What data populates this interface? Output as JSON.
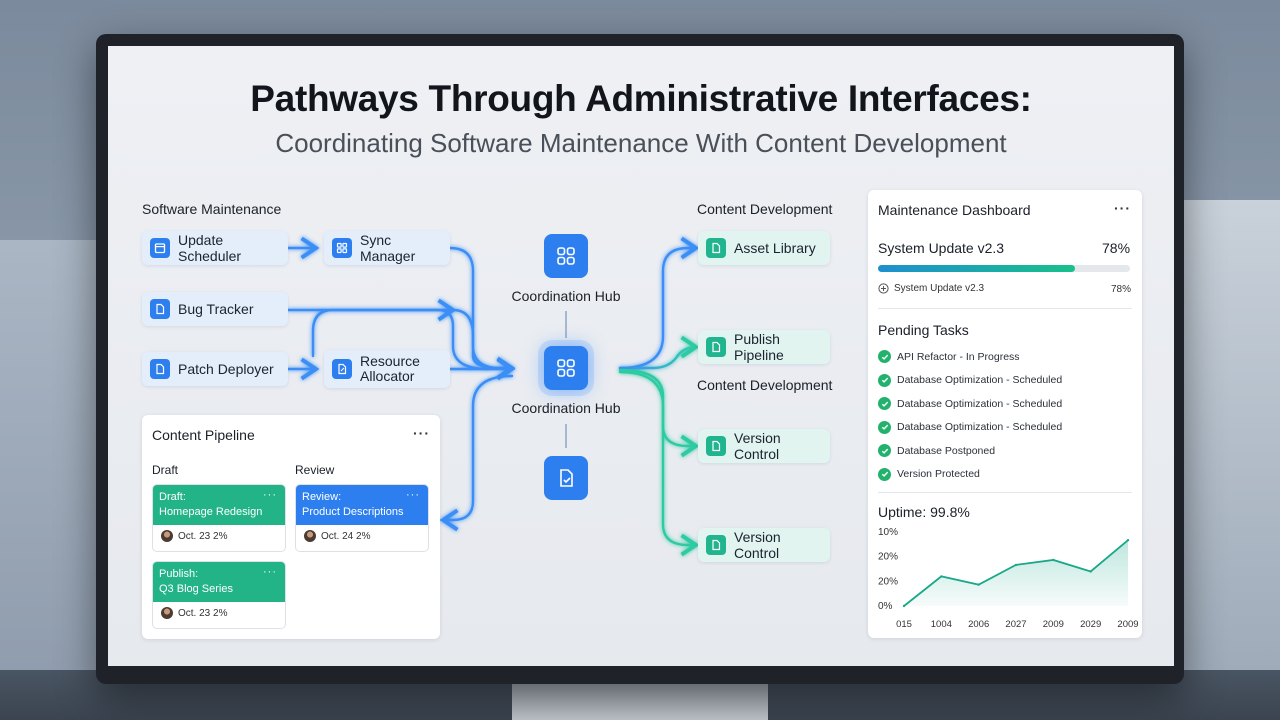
{
  "title": "Pathways Through Administrative Interfaces:",
  "subtitle": "Coordinating Software Maintenance With Content Development",
  "left_section": {
    "label": "Software Maintenance",
    "nodes": [
      "Update Scheduler",
      "Sync Manager",
      "Bug Tracker",
      "Patch Deployer",
      "Resource Allocator"
    ]
  },
  "right_section": {
    "label_top": "Content Development",
    "label_mid": "Content Development",
    "nodes": [
      "Asset Library",
      "Publish Pipeline",
      "Version Control",
      "Version Control"
    ]
  },
  "hubs": {
    "top_label": "Coordination Hub",
    "center_label": "Coordination Hub"
  },
  "content_pipeline": {
    "title": "Content Pipeline",
    "more": "···",
    "columns": [
      "Draft",
      "Review"
    ],
    "cards": [
      {
        "stage": "Draft:",
        "name": "Homepage Redesign",
        "date": "Oct. 23 2%",
        "color": "green"
      },
      {
        "stage": "Review:",
        "name": "Product Descriptions",
        "date": "Oct. 24 2%",
        "color": "blue"
      },
      {
        "stage": "Publish:",
        "name": "Q3 Blog Series",
        "date": "Oct. 23 2%",
        "color": "green"
      }
    ],
    "card_more": "···"
  },
  "dashboard": {
    "title": "Maintenance Dashboard",
    "more": "···",
    "update_name": "System Update v2.3",
    "update_percent": "78%",
    "update_progress": 0.78,
    "update_sub_name": "System Update v2.3",
    "update_sub_percent": "78%",
    "pending_title": "Pending Tasks",
    "tasks": [
      "API Refactor - In Progress",
      "Database Optimization - Scheduled",
      "Database Optimization - Scheduled",
      "Database Optimization - Scheduled",
      "Database Postponed",
      "Version Protected"
    ],
    "uptime_label": "Uptime: 99.8%"
  },
  "chart_data": {
    "type": "area",
    "title": "Uptime: 99.8%",
    "categories": [
      "015",
      "1004",
      "2006",
      "2027",
      "2009",
      "2029",
      "2009"
    ],
    "values": [
      0,
      18,
      13,
      25,
      28,
      21,
      40
    ],
    "y_ticks": [
      "0%",
      "20%",
      "20%",
      "10%"
    ],
    "ylim": [
      0,
      45
    ],
    "color": "#1aa88a"
  },
  "colors": {
    "blue": "#2d7ff0",
    "green": "#21b58f",
    "link_blue": "#3a8ef5",
    "link_green": "#2fd0a8"
  }
}
